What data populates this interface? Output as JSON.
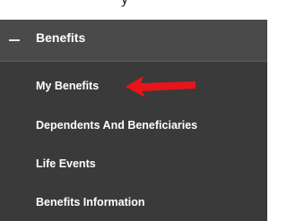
{
  "header_fragment": "y",
  "section": {
    "title": "Benefits",
    "expanded": true
  },
  "menu_items": [
    {
      "label": "My Benefits"
    },
    {
      "label": "Dependents And Beneficiaries"
    },
    {
      "label": "Life Events"
    },
    {
      "label": "Benefits Information"
    }
  ],
  "annotation": {
    "arrow_color": "#e8141b"
  },
  "colors": {
    "menu_background": "#3a3a3a",
    "header_background": "#4a4a4a",
    "text": "#ffffff"
  }
}
